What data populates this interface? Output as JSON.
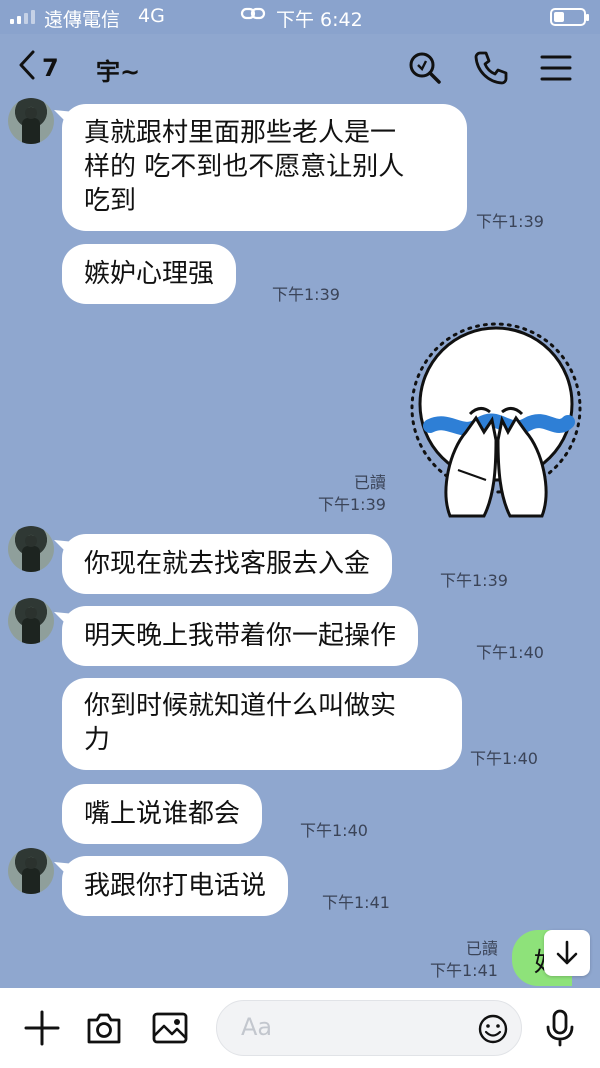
{
  "status_bar": {
    "carrier": "遠傳電信",
    "network": "4G",
    "link_icon": "link-icon",
    "time": "下午 6:42",
    "battery_level": 0.35
  },
  "header": {
    "unread_count": "7",
    "title": "宇~",
    "icons": [
      "search-icon",
      "phone-icon",
      "menu-icon"
    ]
  },
  "messages": [
    {
      "text_lines": [
        "真就跟村里面那些老人是一",
        "样的 吃不到也不愿意让别人",
        "吃到"
      ],
      "time": "下午1:39"
    },
    {
      "text": "嫉妒心理强",
      "time": "下午1:39"
    },
    {
      "sticker": "crying-face-sticker",
      "read": "已讀",
      "time": "下午1:39"
    },
    {
      "text": "你现在就去找客服去入金",
      "time": "下午1:39"
    },
    {
      "text": "明天晚上我带着你一起操作",
      "time": "下午1:40"
    },
    {
      "text_lines": [
        "你到时候就知道什么叫做实",
        "力"
      ],
      "time": "下午1:40"
    },
    {
      "text": "嘴上说谁都会",
      "time": "下午1:40"
    },
    {
      "text": "我跟你打电话说",
      "time": "下午1:41"
    },
    {
      "partial_text": "好",
      "read": "已讀",
      "time": "下午1:41"
    }
  ],
  "input_bar": {
    "placeholder": "Aa",
    "icons": [
      "plus-icon",
      "camera-icon",
      "image-icon",
      "emoji-icon",
      "microphone-icon"
    ]
  },
  "colors": {
    "chat_background": "#8fa7cf",
    "bubble_incoming": "#ffffff",
    "bubble_outgoing": "#8ee27a"
  }
}
